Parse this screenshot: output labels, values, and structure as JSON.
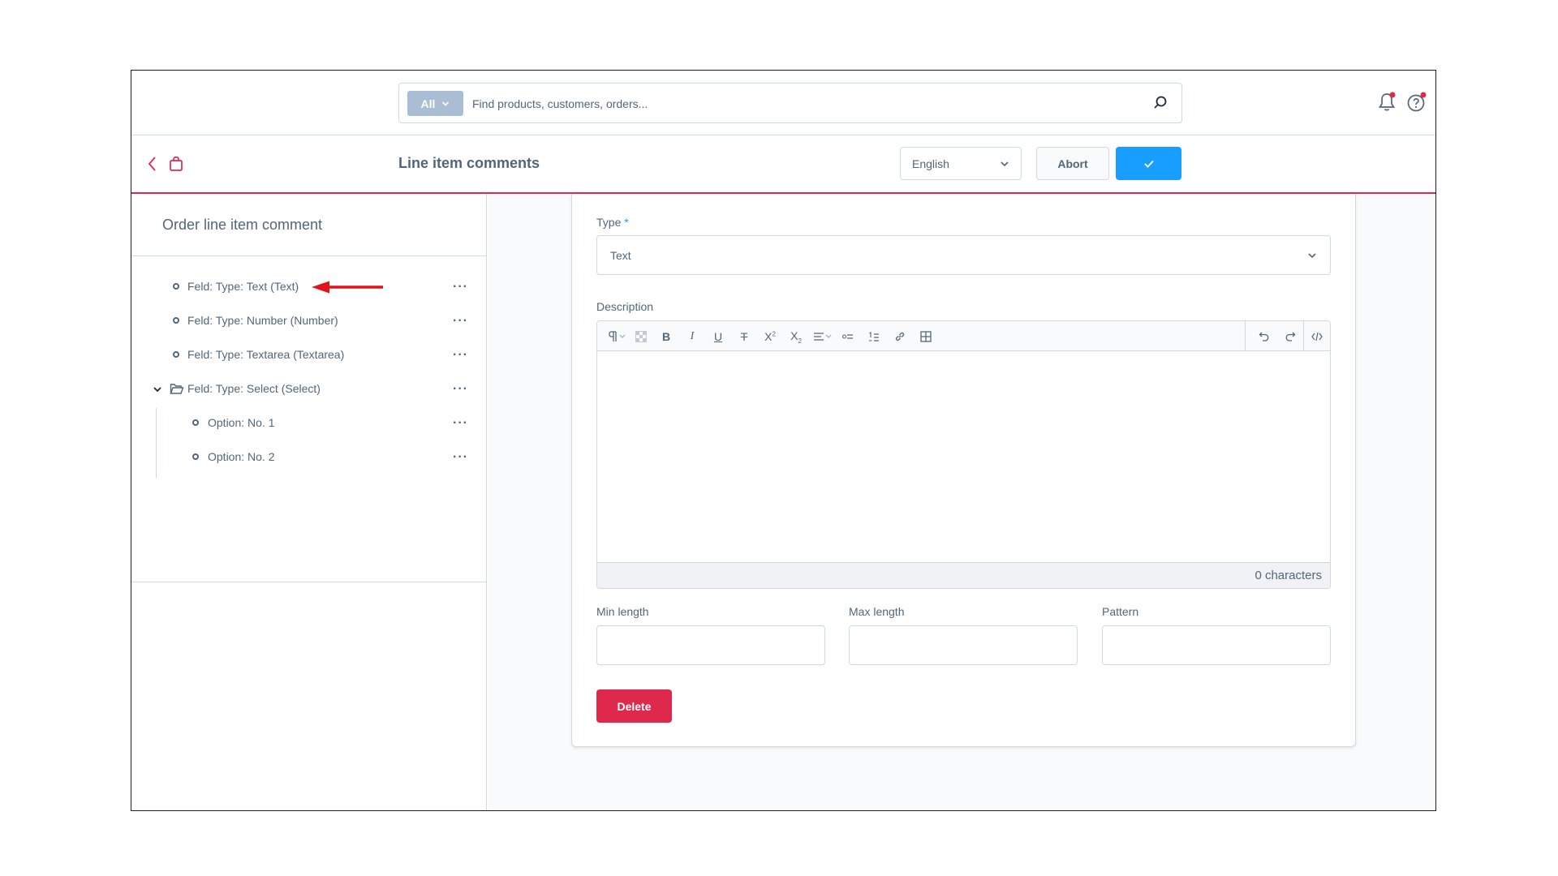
{
  "search": {
    "type_label": "All",
    "placeholder": "Find products, customers, orders..."
  },
  "header": {
    "title": "Line item comments",
    "language": "English",
    "abort_label": "Abort"
  },
  "sidebar": {
    "title": "Order line item comment",
    "items": [
      {
        "label": "Feld: Type: Text (Text)"
      },
      {
        "label": "Feld: Type: Number (Number)"
      },
      {
        "label": "Feld: Type: Textarea (Textarea)"
      },
      {
        "label": "Feld: Type: Select (Select)"
      },
      {
        "label": "Option: No. 1"
      },
      {
        "label": "Option: No. 2"
      }
    ],
    "more_label": "···"
  },
  "form": {
    "type_label": "Type",
    "type_required": "*",
    "type_value": "Text",
    "description_label": "Description",
    "char_count": "0 characters",
    "min_length_label": "Min length",
    "max_length_label": "Max length",
    "pattern_label": "Pattern",
    "delete_label": "Delete"
  },
  "colors": {
    "primary": "#189eff",
    "danger": "#de294c",
    "text": "#52667a",
    "border": "#d1d9e0"
  }
}
